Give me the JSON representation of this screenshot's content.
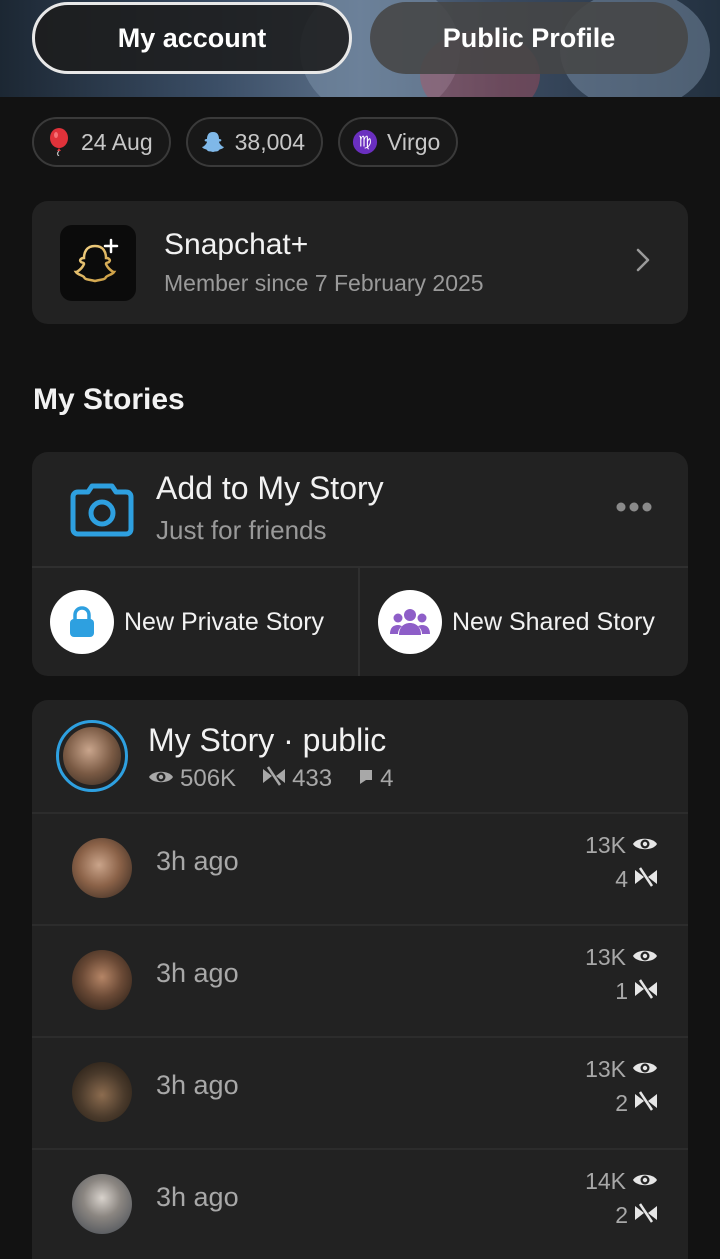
{
  "header": {
    "my_account_label": "My account",
    "public_profile_label": "Public Profile"
  },
  "chips": [
    {
      "icon": "balloon-icon",
      "label": "24 Aug"
    },
    {
      "icon": "snapscore-icon",
      "label": "38,004"
    },
    {
      "icon": "virgo-icon",
      "label": "Virgo"
    }
  ],
  "snapchat_plus": {
    "title": "Snapchat+",
    "subtitle": "Member since 7 February 2025"
  },
  "my_stories": {
    "section_title": "My Stories",
    "add_title": "Add to My Story",
    "add_subtitle": "Just for friends",
    "new_private_label": "New Private Story",
    "new_shared_label": "New Shared Story"
  },
  "my_story": {
    "title": "My Story · public",
    "views": "506K",
    "screenshots": "433",
    "replies": "4"
  },
  "snaps": [
    {
      "time": "3h ago",
      "views": "13K",
      "screenshots": "4"
    },
    {
      "time": "3h ago",
      "views": "13K",
      "screenshots": "1"
    },
    {
      "time": "3h ago",
      "views": "13K",
      "screenshots": "2"
    },
    {
      "time": "3h ago",
      "views": "14K",
      "screenshots": "2"
    }
  ],
  "colors": {
    "accent_blue": "#2ea0e0",
    "purple": "#8e5ec8",
    "background": "#121212",
    "card": "#222222"
  }
}
